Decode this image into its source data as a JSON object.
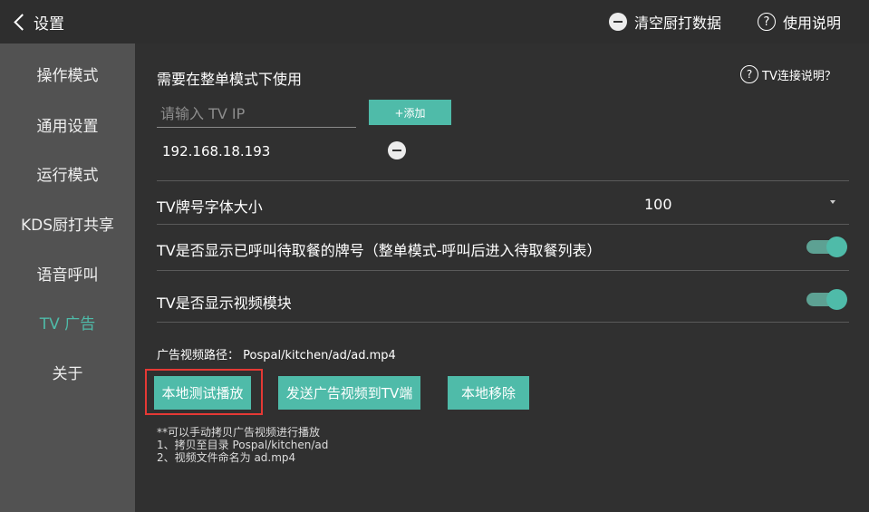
{
  "header": {
    "back_label": "设置",
    "clear_label": "清空厨打数据",
    "help_label": "使用说明"
  },
  "sidebar": {
    "items": [
      {
        "label": "操作模式"
      },
      {
        "label": "通用设置"
      },
      {
        "label": "运行模式"
      },
      {
        "label": "KDS厨打共享"
      },
      {
        "label": "语音呼叫"
      },
      {
        "label": "TV 广告",
        "active": true
      },
      {
        "label": "关于"
      }
    ]
  },
  "main": {
    "section_note": "需要在整单模式下使用",
    "tv_help_label": "TV连接说明？",
    "ip_input": {
      "placeholder": "请输入 TV IP",
      "value": ""
    },
    "add_label": "+添加",
    "ip_list": [
      "192.168.18.193"
    ],
    "font_size": {
      "label": "TV牌号字体大小",
      "value": "100"
    },
    "show_called": {
      "label": "TV是否显示已呼叫待取餐的牌号（整单模式-呼叫后进入待取餐列表）",
      "on": true
    },
    "show_video": {
      "label": "TV是否显示视频模块",
      "on": true
    },
    "video_path": "广告视频路径： Pospal/kitchen/ad/ad.mp4",
    "buttons": {
      "local_play": "本地测试播放",
      "send": "发送广告视频到TV端",
      "remove": "本地移除"
    },
    "notes": [
      "**可以手动拷贝广告视频进行播放",
      "1、拷贝至目录 Pospal/kitchen/ad",
      "2、视频文件命名为 ad.mp4"
    ]
  },
  "colors": {
    "accent": "#4fbba9",
    "sidebar_bg": "#525252",
    "main_bg": "#303030",
    "highlight": "#e53935"
  }
}
